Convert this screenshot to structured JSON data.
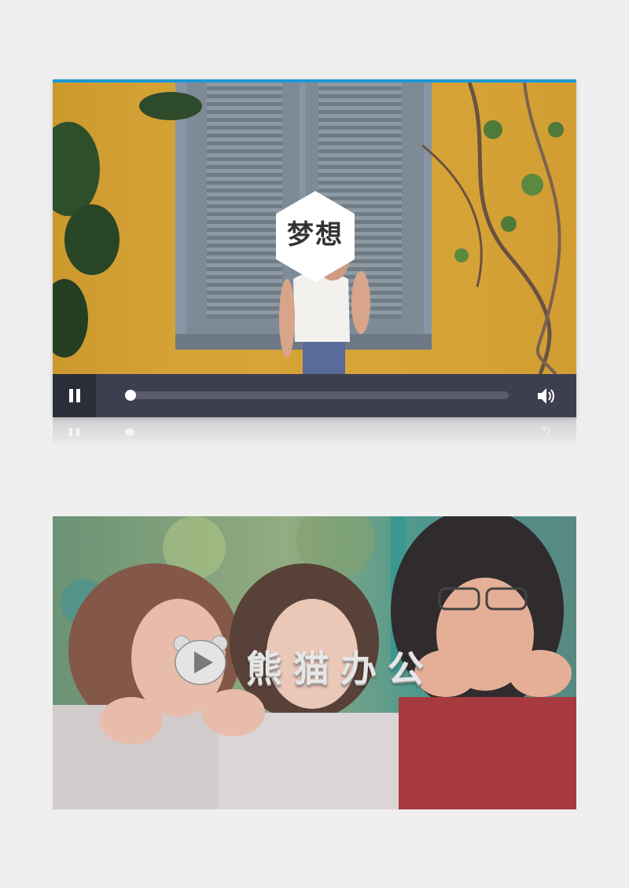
{
  "player": {
    "title_text": "梦想",
    "progress": 0.0,
    "accent_color": "#1a9ad6",
    "controls": {
      "pause_icon": "pause-icon",
      "volume_icon": "volume-icon"
    }
  },
  "banner": {
    "logo_icon": "panda-play-icon",
    "logo_text": "熊猫办公"
  }
}
